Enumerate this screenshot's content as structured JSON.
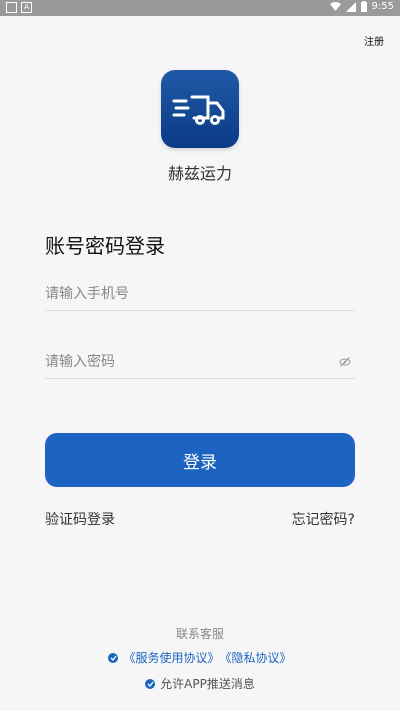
{
  "statusbar": {
    "time": "9:55"
  },
  "header": {
    "register_label": "注册"
  },
  "app": {
    "name": "赫兹运力"
  },
  "form": {
    "title": "账号密码登录",
    "phone_placeholder": "请输入手机号",
    "password_placeholder": "请输入密码",
    "login_label": "登录",
    "code_login_label": "验证码登录",
    "forgot_label": "忘记密码?"
  },
  "footer": {
    "contact_label": "联系客服",
    "service_agreement": "《服务使用协议》",
    "privacy_agreement": "《隐私协议》",
    "push_label": "允许APP推送消息"
  },
  "colors": {
    "accent": "#1d64c2"
  }
}
